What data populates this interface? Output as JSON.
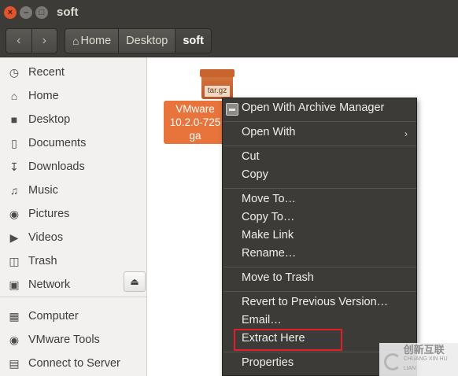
{
  "window": {
    "title": "soft",
    "controls": {
      "close": "×",
      "minimize": "–",
      "maximize": "□"
    }
  },
  "toolbar": {
    "back": "‹",
    "forward": "›",
    "breadcrumbs": [
      {
        "label": "Home",
        "icon": "home-icon"
      },
      {
        "label": "Desktop"
      },
      {
        "label": "soft",
        "active": true
      }
    ]
  },
  "sidebar": {
    "places": [
      {
        "label": "Recent",
        "icon": "clock-icon"
      },
      {
        "label": "Home",
        "icon": "home-icon"
      },
      {
        "label": "Desktop",
        "icon": "folder-icon"
      },
      {
        "label": "Documents",
        "icon": "document-icon"
      },
      {
        "label": "Downloads",
        "icon": "download-icon"
      },
      {
        "label": "Music",
        "icon": "music-icon"
      },
      {
        "label": "Pictures",
        "icon": "camera-icon"
      },
      {
        "label": "Videos",
        "icon": "video-icon"
      },
      {
        "label": "Trash",
        "icon": "trash-icon"
      },
      {
        "label": "Network",
        "icon": "network-icon"
      }
    ],
    "devices": [
      {
        "label": "Computer",
        "icon": "computer-icon"
      },
      {
        "label": "VMware Tools",
        "icon": "disc-icon"
      },
      {
        "label": "Connect to Server",
        "icon": "server-icon"
      }
    ],
    "eject": "⏏"
  },
  "file": {
    "icon_label": "tar.gz",
    "name_lines": [
      "VMware",
      "10.2.0-725",
      "ga"
    ]
  },
  "context_menu": {
    "items": [
      {
        "label": "Open With Archive Manager",
        "icon": "archive-manager-icon"
      },
      {
        "label": "Open With",
        "submenu": "›"
      },
      {
        "label": "Cut"
      },
      {
        "label": "Copy"
      },
      {
        "label": "Move To…"
      },
      {
        "label": "Copy To…"
      },
      {
        "label": "Make Link"
      },
      {
        "label": "Rename…"
      },
      {
        "label": "Move to Trash"
      },
      {
        "label": "Revert to Previous Version…"
      },
      {
        "label": "Email…"
      },
      {
        "label": "Extract Here",
        "highlighted": true
      },
      {
        "label": "Properties"
      }
    ]
  },
  "watermark": {
    "cn": "创新互联",
    "en": "CHUANG XIN HU LIAN"
  },
  "colors": {
    "titlebar": "#3c3b37",
    "accent_orange": "#e8733b",
    "menu_bg": "#3c3b37",
    "highlight_border": "#e21f26",
    "sidebar_bg": "#f2f1f0"
  }
}
